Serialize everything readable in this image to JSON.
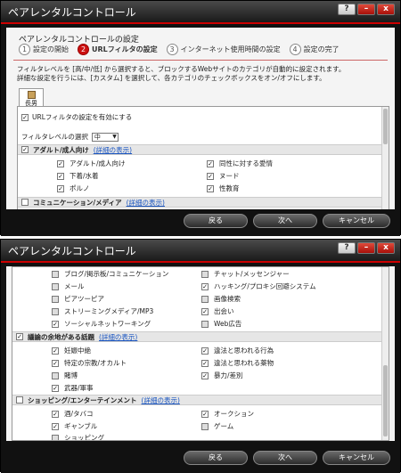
{
  "title": "ペアレンタルコントロール",
  "titlebar_buttons": {
    "help": "?",
    "min": "–",
    "close": "x"
  },
  "buttons": {
    "back": "戻る",
    "next": "次へ",
    "cancel": "キャンセル"
  },
  "w1": {
    "heading": "ペアレンタルコントロールの設定",
    "steps": [
      {
        "num": "1",
        "label": "設定の開始"
      },
      {
        "num": "2",
        "label": "URLフィルタの設定"
      },
      {
        "num": "3",
        "label": "インターネット使用時間の設定"
      },
      {
        "num": "4",
        "label": "設定の完了"
      }
    ],
    "desc1": "フィルタレベルを [高/中/低] から選択すると、ブロックするWebサイトのカテゴリが自動的に設定されます。",
    "desc2": "詳細な設定を行うには、[カスタム] を選択して、各カテゴリのチェックボックスをオン/オフにします。",
    "tab_label": "長男",
    "enable_label": "URLフィルタの設定を有効にする",
    "level_label": "フィルタレベルの選択",
    "level_value": "中",
    "cat1": {
      "name": "アダルト/成人向け",
      "link": "(詳細の表示)"
    },
    "items": [
      {
        "l": "アダルト/成人向け",
        "r": "同性に対する愛情"
      },
      {
        "l": "下着/水着",
        "r": "ヌード"
      },
      {
        "l": "ポルノ",
        "r": "性教育"
      }
    ],
    "cat2": {
      "name": "コミュニケーション/メディア",
      "link": "(詳細の表示)"
    }
  },
  "w2": {
    "items_a": [
      {
        "l": "ブログ/掲示板/コミュニケーション",
        "r": "チャット/メッセンジャー"
      },
      {
        "l": "メール",
        "r": "ハッキング/プロキシ回避システム"
      },
      {
        "l": "ピアツーピア",
        "r": "画像検索"
      },
      {
        "l": "ストリーミングメディア/MP3",
        "r": "出会い"
      },
      {
        "l": "ソーシャルネットワーキング",
        "r": "Web広告"
      }
    ],
    "cat3": {
      "name": "議論の余地がある話題",
      "link": "(詳細の表示)"
    },
    "items_b": [
      {
        "l": "妊娠中絶",
        "r": "違法と思われる行為"
      },
      {
        "l": "特定の宗教/オカルト",
        "r": "違法と思われる薬物"
      },
      {
        "l": "賭博",
        "r": "暴力/差別"
      },
      {
        "l": "武器/軍事",
        "r": ""
      }
    ],
    "cat4": {
      "name": "ショッピング/エンターテインメント",
      "link": "(詳細の表示)"
    },
    "items_c": [
      {
        "l": "酒/タバコ",
        "r": "オークション"
      },
      {
        "l": "ギャンブル",
        "r": "ゲーム"
      },
      {
        "l": "ショッピング",
        "r": ""
      }
    ]
  },
  "colors": {
    "accent": "#cc1010",
    "link": "#1a55c0"
  }
}
